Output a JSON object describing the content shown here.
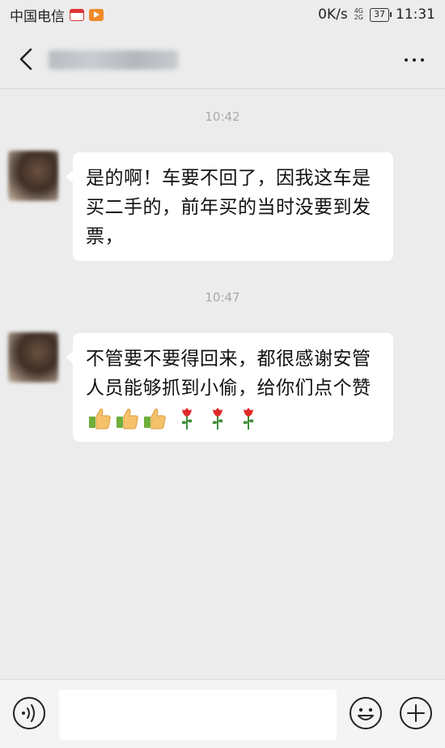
{
  "status_bar": {
    "carrier": "中国电信",
    "speed": "0K/s",
    "network_top": "4G",
    "network_bottom": "2G",
    "battery": "37",
    "time": "11:31"
  },
  "header": {
    "title": "",
    "back_icon": "back-arrow-icon",
    "more_icon": "more-dots-icon"
  },
  "messages": [
    {
      "timestamp": "10:42",
      "text": "是的啊！车要不回了，因我这车是买二手的，前年买的当时没要到发票，"
    },
    {
      "timestamp": "10:47",
      "text": "不管要不要得回来，都很感谢安管人员能够抓到小偷，给你们点个赞",
      "emojis": [
        "thumbs-up",
        "thumbs-up",
        "thumbs-up",
        "rose",
        "rose",
        "rose"
      ]
    }
  ],
  "input_bar": {
    "placeholder": "",
    "voice_icon": "voice-icon",
    "emoji_icon": "smiley-icon",
    "plus_icon": "plus-icon"
  },
  "colors": {
    "background": "#ececec",
    "bubble": "#ffffff",
    "timestamp": "#a9a9a9"
  }
}
